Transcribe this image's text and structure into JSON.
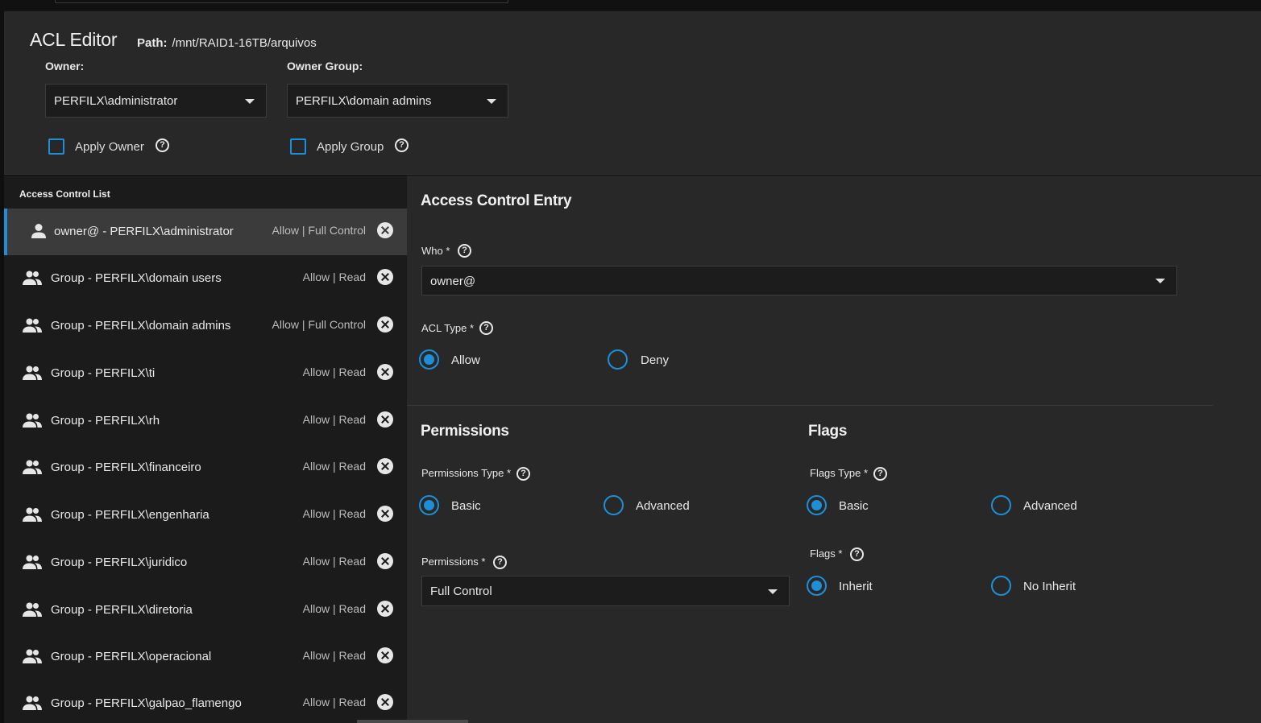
{
  "header": {
    "title": "ACL Editor",
    "path_label": "Path:",
    "path_value": "/mnt/RAID1-16TB/arquivos",
    "owner_label": "Owner:",
    "owner_value": "PERFILX\\administrator",
    "group_label": "Owner Group:",
    "group_value": "PERFILX\\domain admins",
    "apply_owner_label": "Apply Owner",
    "apply_group_label": "Apply Group"
  },
  "acl_list": {
    "title": "Access Control List",
    "items": [
      {
        "name": "owner@ - PERFILX\\administrator",
        "perm": "Allow | Full Control",
        "icon": "person-icon"
      },
      {
        "name": "Group - PERFILX\\domain users",
        "perm": "Allow | Read",
        "icon": "group-icon"
      },
      {
        "name": "Group - PERFILX\\domain admins",
        "perm": "Allow | Full Control",
        "icon": "group-icon"
      },
      {
        "name": "Group - PERFILX\\ti",
        "perm": "Allow | Read",
        "icon": "group-icon"
      },
      {
        "name": "Group - PERFILX\\rh",
        "perm": "Allow | Read",
        "icon": "group-icon"
      },
      {
        "name": "Group - PERFILX\\financeiro",
        "perm": "Allow | Read",
        "icon": "group-icon"
      },
      {
        "name": "Group - PERFILX\\engenharia",
        "perm": "Allow | Read",
        "icon": "group-icon"
      },
      {
        "name": "Group - PERFILX\\juridico",
        "perm": "Allow | Read",
        "icon": "group-icon"
      },
      {
        "name": "Group - PERFILX\\diretoria",
        "perm": "Allow | Read",
        "icon": "group-icon"
      },
      {
        "name": "Group - PERFILX\\operacional",
        "perm": "Allow | Read",
        "icon": "group-icon"
      },
      {
        "name": "Group - PERFILX\\galpao_flamengo",
        "perm": "Allow | Read",
        "icon": "group-icon"
      }
    ]
  },
  "ace": {
    "title": "Access Control Entry",
    "who_label": "Who *",
    "who_value": "owner@",
    "acl_type_label": "ACL Type *",
    "acl_type_options": [
      "Allow",
      "Deny"
    ],
    "acl_type_selected": "Allow",
    "permissions_title": "Permissions",
    "permissions_type_label": "Permissions Type *",
    "permissions_type_options": [
      "Basic",
      "Advanced"
    ],
    "permissions_type_selected": "Basic",
    "permissions_label": "Permissions *",
    "permissions_value": "Full Control",
    "flags_title": "Flags",
    "flags_type_label": "Flags Type *",
    "flags_type_options": [
      "Basic",
      "Advanced"
    ],
    "flags_type_selected": "Basic",
    "flags_label": "Flags *",
    "flags_options": [
      "Inherit",
      "No Inherit"
    ],
    "flags_selected": "Inherit"
  },
  "colors": {
    "accent": "#1e8fd6",
    "panel": "#282828",
    "list_bg": "#1b1b1b",
    "selected_row": "#3b3b3b"
  }
}
